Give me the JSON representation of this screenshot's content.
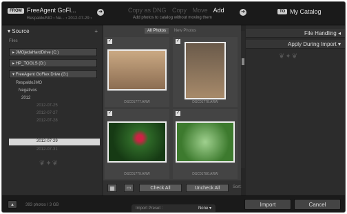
{
  "header": {
    "from_badge": "FROM",
    "source_name": "FreeAgent GoFl...",
    "source_path": "Respaldo/MO › Ne... › 2012-07-29 ›",
    "modes": [
      "Copy as DNG",
      "Copy",
      "Move",
      "Add"
    ],
    "active_mode": "Add",
    "mode_sub": "Add photos to catalog without moving them",
    "to_badge": "TO",
    "dest_name": "My Catalog"
  },
  "source": {
    "title": "Source",
    "section": "Files",
    "volumes": [
      "JMOjedaHardDrive (C:)",
      "HP_TOOLS (D:)",
      "FreeAgent GoFlex Drive (G:)"
    ],
    "tree": [
      {
        "label": "RespaldoJMO"
      },
      {
        "label": "Negativos"
      },
      {
        "label": "2012"
      },
      {
        "label": "2012-07-25"
      },
      {
        "label": "2012-07-27"
      },
      {
        "label": "2012-07-28"
      },
      {
        "label": "2012-07-29"
      },
      {
        "label": "2012-07-31"
      }
    ]
  },
  "grid": {
    "tabs": [
      "All Photos",
      "New Photos"
    ],
    "photos": [
      {
        "name": "DSC01777.ARW"
      },
      {
        "name": "DSC01778.ARW"
      },
      {
        "name": "DSC01779.ARW"
      },
      {
        "name": "DSC01780.ARW"
      }
    ],
    "check_all": "Check All",
    "uncheck_all": "Uncheck All",
    "sort": "Sort:"
  },
  "right": {
    "file_handling": "File Handling",
    "apply_import": "Apply During Import"
  },
  "footer": {
    "count": "393 photos / 3 GB",
    "preset_label": "Import Preset :",
    "preset_value": "None",
    "import": "Import",
    "cancel": "Cancel"
  }
}
